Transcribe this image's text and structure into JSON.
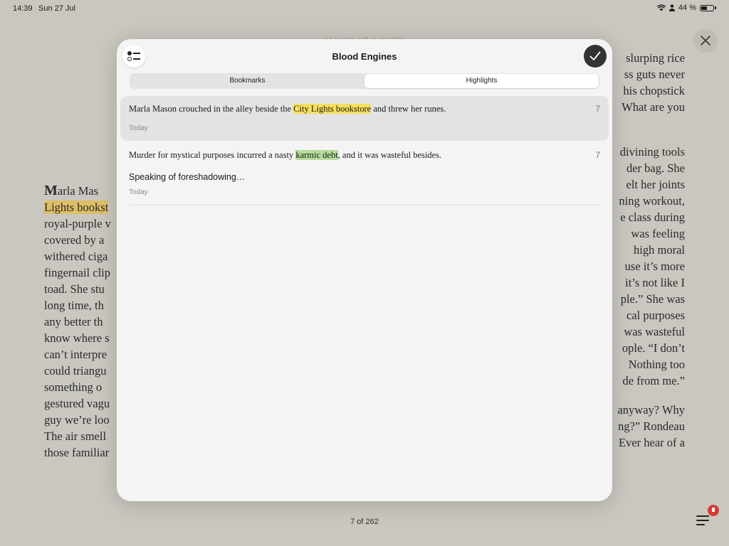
{
  "status_bar": {
    "time": "14:39",
    "date": "Sun 27 Jul",
    "battery": "44 %",
    "battery_level": 0.44
  },
  "book": {
    "left_lines": [
      {
        "dropcap": "M",
        "text": "arla Mas"
      },
      {
        "highlight": "Lights bookst",
        "text": ""
      },
      {
        "text": "royal-purple v"
      },
      {
        "text": "covered by a"
      },
      {
        "text": "withered ciga"
      },
      {
        "text": "fingernail clip"
      },
      {
        "text": "toad. She stu"
      },
      {
        "text": "long time, th"
      },
      {
        "text": "any better th"
      },
      {
        "text": "know where s"
      },
      {
        "text": "can’t interpre"
      },
      {
        "text": "could triangu"
      },
      {
        "text": "something o"
      },
      {
        "text": "gestured vagu"
      },
      {
        "text": "guy we’re loo"
      },
      {
        "text": "The air smell"
      },
      {
        "text": "those familiar"
      }
    ],
    "right_lines_a": [
      "slurping rice",
      "ss guts never",
      "his chopstick",
      "What are you"
    ],
    "right_lines_b": [
      "divining tools",
      "der bag. She",
      "elt her joints",
      "ning workout,",
      "e class during",
      "was feeling",
      "high moral",
      "use it’s more",
      "it’s not like I",
      "ple.” She was",
      "cal purposes",
      "was wasteful",
      "ople. “I don’t",
      "Nothing too",
      "de from me.”"
    ],
    "right_lines_c": [
      "anyway? Why",
      "ng?” Rondeau",
      "Ever hear of a"
    ],
    "faint_header": "13 pages left in chapter",
    "page_indicator": "7 of 262"
  },
  "modal": {
    "title": "Blood Engines",
    "tabs": [
      {
        "label": "Bookmarks",
        "active": false
      },
      {
        "label": "Highlights",
        "active": true
      }
    ],
    "highlights": [
      {
        "before": "Marla Mason crouched in the alley beside the ",
        "highlight": "City Lights bookstore",
        "after": " and threw her runes.",
        "color": "#f6df5d",
        "page": "7",
        "note": "",
        "date": "Today",
        "selected": true
      },
      {
        "before": "Murder for mystical purposes incurred a nasty ",
        "highlight": "karmic debt",
        "after": ", and it was wasteful besides.",
        "color": "#b6dc9c",
        "page": "7",
        "note": "Speaking of foreshadowing…",
        "date": "Today",
        "selected": false
      }
    ]
  },
  "icons": {
    "filter": "filter-list-icon",
    "done": "checkmark-icon",
    "close": "close-icon",
    "toc": "table-of-contents-icon",
    "wifi": "wifi-icon",
    "location": "person-icon",
    "battery": "battery-icon"
  }
}
